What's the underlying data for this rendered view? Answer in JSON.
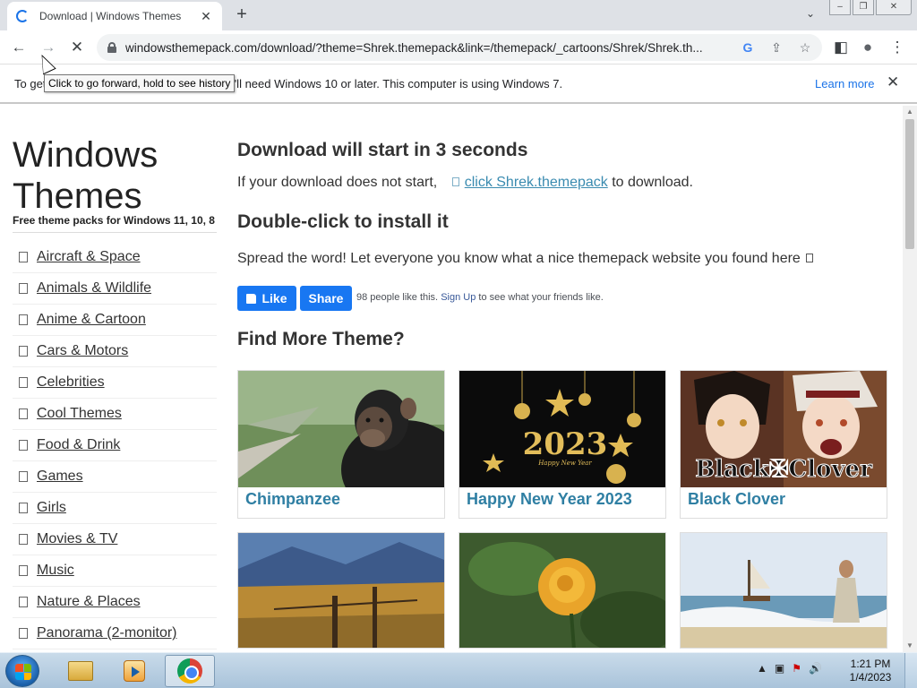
{
  "browser": {
    "tab_title": "Download | Windows Themes",
    "tab_close": "✕",
    "new_tab": "+",
    "tab_search": "⌄",
    "url": "windowsthemepack.com/download/?theme=Shrek.themepack&link=/themepack/_cartoons/Shrek/Shrek.th...",
    "window_controls": {
      "minimize": "‒",
      "maximize": "❐",
      "close": "✕"
    },
    "nav": {
      "back": "←",
      "forward": "→",
      "reload": "✕"
    },
    "toolbar_icons": {
      "google": "G",
      "share": "⇪",
      "bookmark": "☆",
      "sidepanel": "◧",
      "profile": "●",
      "menu": "⋮"
    }
  },
  "infobar": {
    "text": "To get future Google Chrome updates, you'll need Windows 10 or later. This computer is using Windows 7.",
    "learn_more": "Learn more",
    "close": "✕",
    "tooltip": "Click to go forward, hold to see history"
  },
  "sidebar": {
    "title": "Windows Themes",
    "subtitle": "Free theme packs for Windows 11, 10, 8",
    "categories": [
      "Aircraft & Space",
      "Animals & Wildlife",
      "Anime & Cartoon",
      "Cars & Motors",
      "Celebrities",
      "Cool Themes",
      "Food & Drink",
      "Games",
      "Girls",
      "Movies & TV",
      "Music",
      "Nature & Places",
      "Panorama (2-monitor)"
    ]
  },
  "main": {
    "download_heading": "Download will start in 3 seconds",
    "download_prefix": "If your download does not start,",
    "download_link": "click Shrek.themepack",
    "download_suffix": "to download.",
    "install_heading": "Double-click to install it",
    "spread_text": "Spread the word! Let everyone you know what a nice themepack website you found here",
    "fb_like": "Like",
    "fb_share": "Share",
    "fb_count": "98 people like this.",
    "fb_signup": "Sign Up",
    "fb_suffix": "to see what your friends like.",
    "more_heading": "Find More Theme?",
    "themes": [
      {
        "title": "Chimpanzee"
      },
      {
        "title": "Happy New Year 2023"
      },
      {
        "title": "Black Clover"
      }
    ],
    "new_year_art_text": "2023",
    "new_year_art_sub": "Happy New Year",
    "black_clover_logo": "Black✠Clover"
  },
  "taskbar": {
    "time": "1:21 PM",
    "date": "1/4/2023",
    "tray": {
      "chevron": "▲",
      "network": "▣",
      "flag": "⚑",
      "volume": "🔊"
    }
  },
  "colors": {
    "link_blue": "#3a8bb0",
    "card_title": "#2f7fa3",
    "facebook": "#1877f2",
    "chrome_accent": "#1a73e8"
  }
}
